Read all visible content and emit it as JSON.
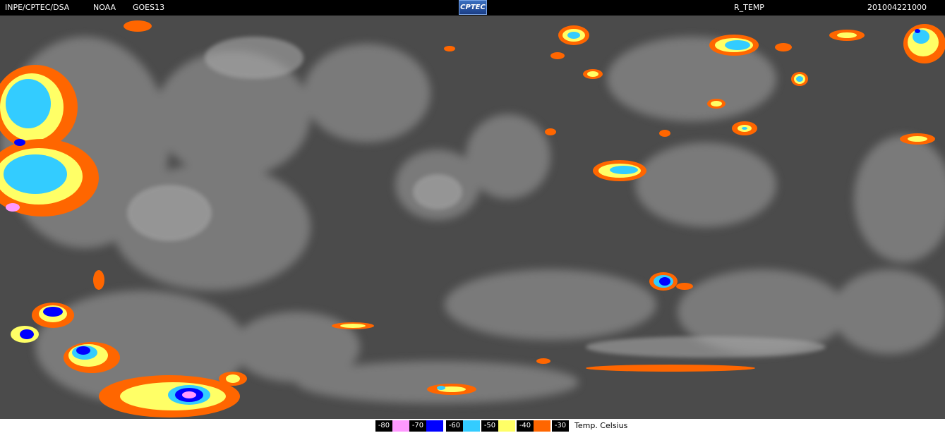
{
  "header": {
    "source": "INPE/CPTEC/DSA",
    "agency": "NOAA",
    "satellite": "GOES13",
    "logo_text": "CPTEC",
    "product": "R_TEMP",
    "timestamp": "201004221000"
  },
  "legend": {
    "unit_label": "Temp. Celsius",
    "items": [
      {
        "label": "-80",
        "color": "#ff99ff"
      },
      {
        "label": "-70",
        "color": "#0000ff"
      },
      {
        "label": "-60",
        "color": "#33ccff"
      },
      {
        "label": "-50",
        "color": "#ffff66"
      },
      {
        "label": "-40",
        "color": "#ff6600"
      },
      {
        "label": "-30",
        "color": ""
      }
    ]
  },
  "colors": {
    "background_cloudfree": "#4b4b4b",
    "cloud_gray": "#9a9a9a",
    "orange": "#ff6600",
    "yellow": "#ffff66",
    "cyan": "#33ccff",
    "blue": "#0000ff",
    "pink": "#ff99ff"
  }
}
